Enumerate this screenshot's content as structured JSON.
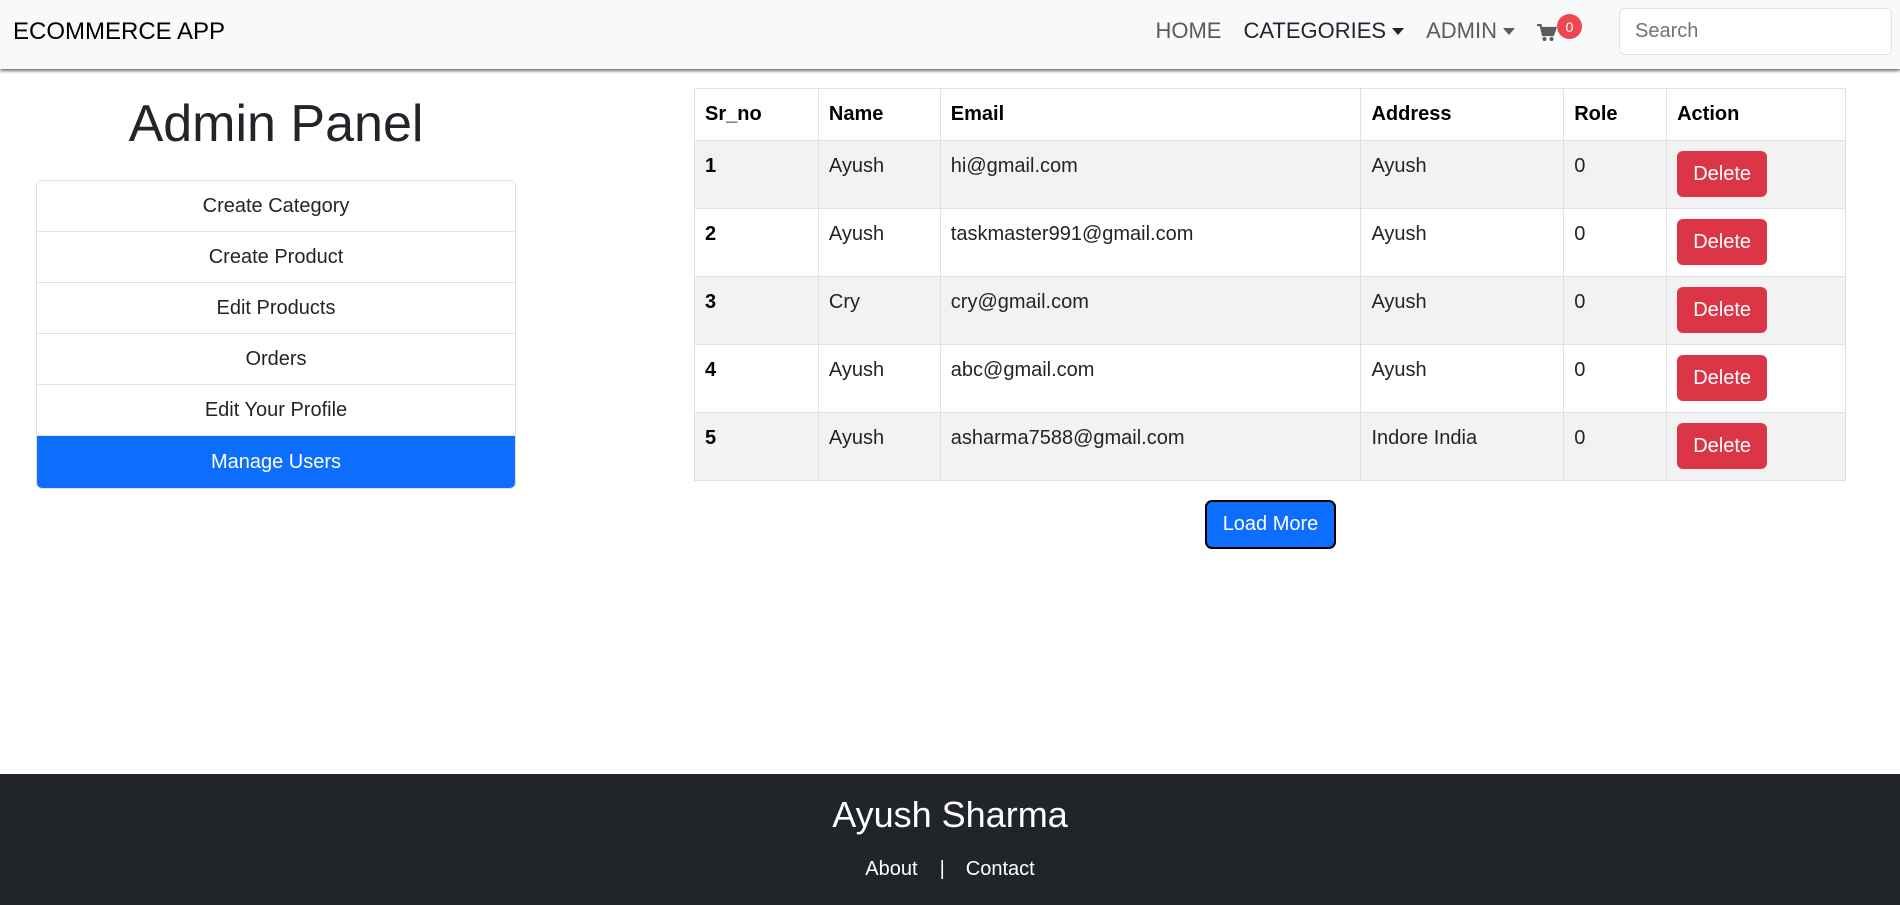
{
  "navbar": {
    "brand": "ECOMMERCE APP",
    "home": "HOME",
    "categories": "CATEGORIES",
    "admin": "ADMIN",
    "cart_count": "0",
    "search_placeholder": "Search"
  },
  "sidebar": {
    "title": "Admin Panel",
    "items": [
      {
        "label": "Create Category"
      },
      {
        "label": "Create Product"
      },
      {
        "label": "Edit Products"
      },
      {
        "label": "Orders"
      },
      {
        "label": "Edit Your Profile"
      },
      {
        "label": "Manage Users"
      }
    ]
  },
  "table": {
    "headers": [
      "Sr_no",
      "Name",
      "Email",
      "Address",
      "Role",
      "Action"
    ],
    "rows": [
      {
        "sr": "1",
        "name": "Ayush",
        "email": "hi@gmail.com",
        "address": "Ayush",
        "role": "0",
        "action": "Delete"
      },
      {
        "sr": "2",
        "name": "Ayush",
        "email": "taskmaster991@gmail.com",
        "address": "Ayush",
        "role": "0",
        "action": "Delete"
      },
      {
        "sr": "3",
        "name": "Cry",
        "email": "cry@gmail.com",
        "address": "Ayush",
        "role": "0",
        "action": "Delete"
      },
      {
        "sr": "4",
        "name": "Ayush",
        "email": "abc@gmail.com",
        "address": "Ayush",
        "role": "0",
        "action": "Delete"
      },
      {
        "sr": "5",
        "name": "Ayush",
        "email": "asharma7588@gmail.com",
        "address": "Indore India",
        "role": "0",
        "action": "Delete"
      }
    ],
    "load_more": "Load More"
  },
  "footer": {
    "title": "Ayush Sharma",
    "about": "About",
    "separator": "|",
    "contact": "Contact"
  },
  "colors": {
    "primary": "#0d6efd",
    "danger": "#dc3545",
    "footer_bg": "#212529",
    "badge": "#f0464f"
  },
  "icons": {
    "cart": "cart-icon",
    "caret": "caret-down-icon"
  }
}
